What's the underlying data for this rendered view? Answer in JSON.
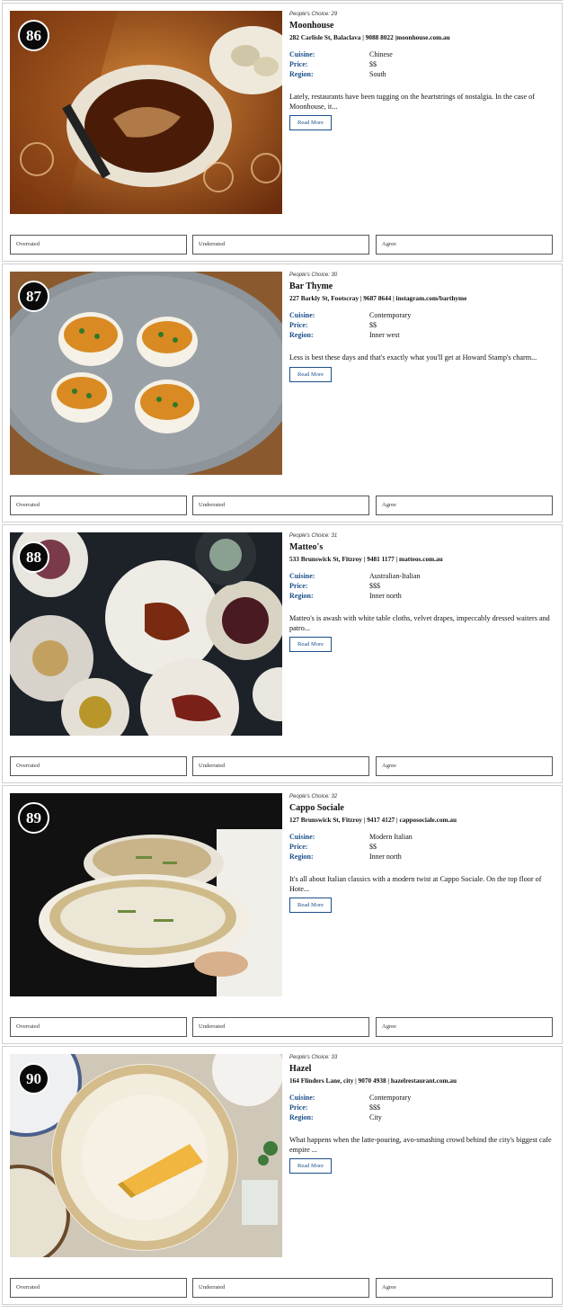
{
  "restaurants": [
    {
      "rank": "86",
      "peoples_choice": "People's Choice: 29",
      "name": "Moonhouse",
      "address": "282 Carlisle St, Balaclava | 9088 8022 |moonhouse.com.au",
      "cuisine_label": "Cuisine:",
      "cuisine": "Chinese",
      "price_label": "Price:",
      "price": "$$",
      "region_label": "Region:",
      "region": "South",
      "description": "Lately, restaurants have been tugging on the heartstrings of nostalgia. In the case of Moonhouse, it...",
      "read_more": "Read More",
      "votes": [
        "Overrated",
        "Underrated",
        "Agree"
      ]
    },
    {
      "rank": "87",
      "peoples_choice": "People's Choice: 30",
      "name": "Bar Thyme",
      "address": "227 Barkly St, Footscray | 9687 8644 | instagram.com/barthyme",
      "cuisine_label": "Cuisine:",
      "cuisine": "Contemporary",
      "price_label": "Price:",
      "price": "$$",
      "region_label": "Region:",
      "region": "Inner west",
      "description": "Less is best these days and that's exactly what you'll get at Howard Stamp's charm...",
      "read_more": "Read More",
      "votes": [
        "Overrated",
        "Underrated",
        "Agree"
      ]
    },
    {
      "rank": "88",
      "peoples_choice": "People's Choice: 31",
      "name": "Matteo's",
      "address": "533 Brunswick St, Fitzroy | 9481 1177 | matteos.com.au",
      "cuisine_label": "Cuisine:",
      "cuisine": "Australian-Italian",
      "price_label": "Price:",
      "price": "$$$",
      "region_label": "Region:",
      "region": "Inner north",
      "description": "Matteo's is awash with white table cloths, velvet drapes, impeccably dressed waiters and patro...",
      "read_more": "Read More",
      "votes": [
        "Overrated",
        "Underrated",
        "Agree"
      ]
    },
    {
      "rank": "89",
      "peoples_choice": "People's Choice: 32",
      "name": "Cappo Sociale",
      "address": "127 Brunswick St, Fitzroy | 9417 4127 | capposociale.com.au",
      "cuisine_label": "Cuisine:",
      "cuisine": "Modern Italian",
      "price_label": "Price:",
      "price": "$$",
      "region_label": "Region:",
      "region": "Inner north",
      "description": "It's all about Italian classics with a modern twist at Cappo Sociale. On the top floor of Hote...",
      "read_more": "Read More",
      "votes": [
        "Overrated",
        "Underrated",
        "Agree"
      ]
    },
    {
      "rank": "90",
      "peoples_choice": "People's Choice: 33",
      "name": "Hazel",
      "address": "164 Flinders Lane, city | 9070 4938 | hazelrestaurant.com.au",
      "cuisine_label": "Cuisine:",
      "cuisine": "Contemporary",
      "price_label": "Price:",
      "price": "$$$",
      "region_label": "Region:",
      "region": "City",
      "description": "What happens when the latte-pouring, avo-smashing crowd behind the city's biggest cafe empire ...",
      "read_more": "Read More",
      "votes": [
        "Overrated",
        "Underrated",
        "Agree"
      ]
    }
  ]
}
